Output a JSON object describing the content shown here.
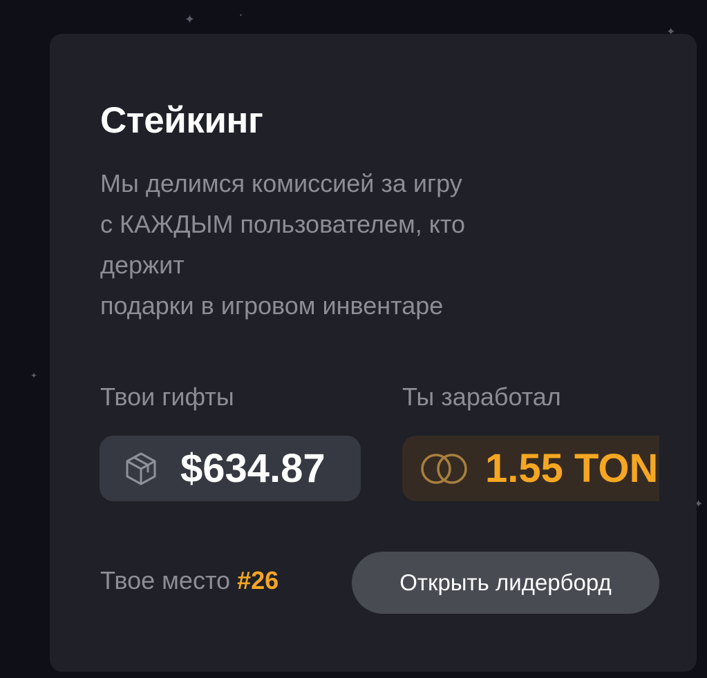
{
  "card": {
    "title": "Стейкинг",
    "description_lines": [
      "Мы делимся комиссией за игру",
      "с КАЖДЫМ пользователем, кто",
      "держит",
      "подарки в игровом инвентаре"
    ]
  },
  "stats": {
    "gifts": {
      "label": "Твои гифты",
      "value": "$634.87",
      "icon": "gift-box-icon"
    },
    "earned": {
      "label": "Ты заработал",
      "value": "1.55 TON",
      "icon": "coins-icon"
    }
  },
  "rank": {
    "label": "Твое место",
    "value": "#26"
  },
  "leaderboard_button": {
    "label": "Открыть лидерборд"
  },
  "colors": {
    "page_background": "#0e0f17",
    "card_background": "#1f2028",
    "accent": "#f5a623",
    "muted_text": "#8c8d96",
    "button_background": "#494b53"
  }
}
